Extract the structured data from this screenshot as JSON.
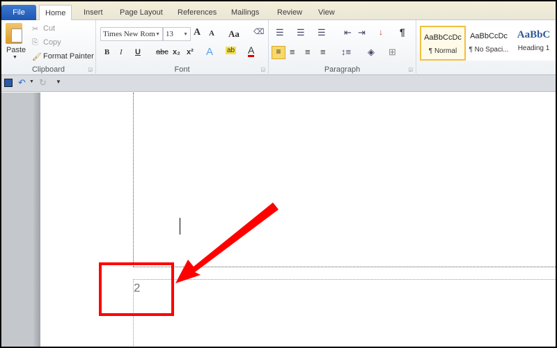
{
  "tabs": [
    "File",
    "Home",
    "Insert",
    "Page Layout",
    "References",
    "Mailings",
    "Review",
    "View"
  ],
  "active_tab": "Home",
  "clipboard": {
    "paste": "Paste",
    "cut": "Cut",
    "copy": "Copy",
    "format_painter": "Format Painter",
    "label": "Clipboard"
  },
  "font": {
    "name": "Times New Rom",
    "size": "13",
    "label": "Font",
    "bold": "B",
    "italic": "I",
    "underline": "U",
    "strike": "abc",
    "sub": "x₂",
    "sup": "x²",
    "grow": "A",
    "shrink": "A",
    "case": "Aa",
    "color": "A",
    "font_color_hex": "#e00000"
  },
  "paragraph": {
    "label": "Paragraph",
    "pilcrow": "¶"
  },
  "styles": [
    {
      "preview": "AaBbCcDc",
      "name": "¶ Normal"
    },
    {
      "preview": "AaBbCcDc",
      "name": "¶ No Spaci..."
    },
    {
      "preview": "AaBbC",
      "name": "Heading 1"
    }
  ],
  "document": {
    "page_number": "2"
  },
  "colors": {
    "annotation": "#ff0000",
    "highlight": "#f7d86b"
  }
}
